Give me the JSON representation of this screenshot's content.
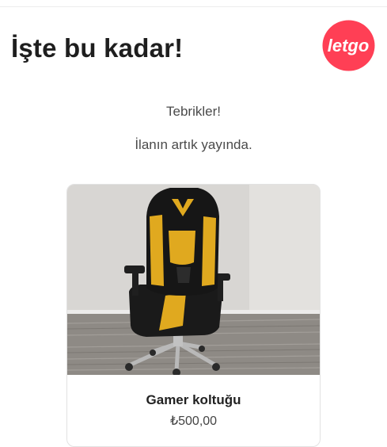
{
  "header": {
    "title": "İşte bu kadar!",
    "logo_text": "letgo",
    "logo_color": "#ff3f55"
  },
  "messages": {
    "congrats": "Tebrikler!",
    "published": "İlanın artık yayında."
  },
  "listing": {
    "title": "Gamer koltuğu",
    "price": "₺500,00",
    "image": "gaming-chair-photo"
  }
}
